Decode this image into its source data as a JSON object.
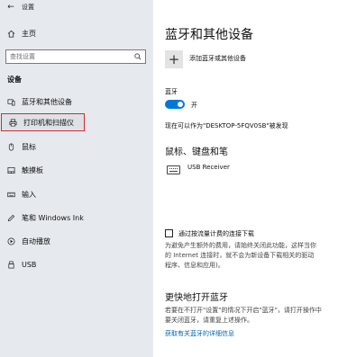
{
  "window": {
    "title": "设置"
  },
  "sidebar": {
    "home_label": "主页",
    "search_placeholder": "查找设置",
    "section_label": "设备",
    "items": [
      {
        "label": "蓝牙和其他设备",
        "icon": "bluetooth-devices-icon",
        "selected": false
      },
      {
        "label": "打印机和扫描仪",
        "icon": "printer-icon",
        "selected": true
      },
      {
        "label": "鼠标",
        "icon": "mouse-icon",
        "selected": false
      },
      {
        "label": "触摸板",
        "icon": "touchpad-icon",
        "selected": false
      },
      {
        "label": "输入",
        "icon": "keyboard-icon",
        "selected": false
      },
      {
        "label": "笔和 Windows Ink",
        "icon": "pen-icon",
        "selected": false
      },
      {
        "label": "自动播放",
        "icon": "autoplay-icon",
        "selected": false
      },
      {
        "label": "USB",
        "icon": "usb-icon",
        "selected": false
      }
    ]
  },
  "main": {
    "title": "蓝牙和其他设备",
    "add_device_label": "添加蓝牙或其他设备",
    "bluetooth_label": "蓝牙",
    "toggle_state_label": "开",
    "discoverable_text": "现在可以作为\"DESKTOP-5FQV0SB\"被发现",
    "mouse_section_title": "鼠标、键盘和笔",
    "device_name": "USB Receiver",
    "metered_checkbox_label": "通过按流量计费的连接下载",
    "metered_desc": [
      "为避免产生额外的费用，请始终关闭此功能，这样当你",
      "的 Internet 连接时，就不会为新设备下载相关的驱动",
      "程序、信息和应用)。"
    ],
    "quick_title": "更快地打开蓝牙",
    "quick_desc": [
      "若要在不打开\"设置\"的情况下开启\"蓝牙\"，请打开操作中",
      "要关闭蓝牙，请重复上述操作。"
    ],
    "more_link": "获取有关蓝牙的详细信息"
  },
  "colors": {
    "accent": "#0078d7",
    "selected_outline": "#d9262a",
    "link": "#0066b4"
  }
}
